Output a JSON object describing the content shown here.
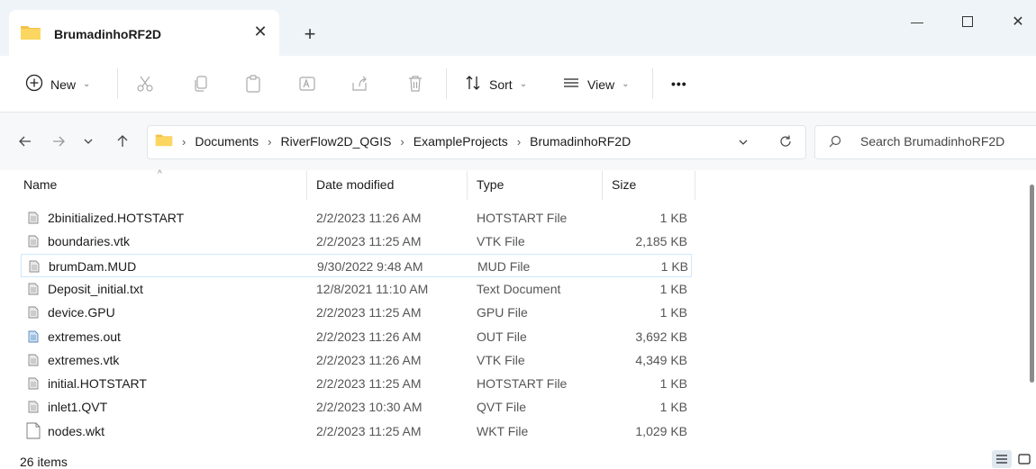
{
  "window": {
    "tab_title": "BrumadinhoRF2D",
    "new_tab": "+",
    "close_tab": "✕",
    "minimize": "—",
    "maximize": "☐",
    "close": "✕"
  },
  "commands": {
    "new_label": "New",
    "sort_label": "Sort",
    "view_label": "View",
    "more_label": "•••"
  },
  "breadcrumbs": [
    "Documents",
    "RiverFlow2D_QGIS",
    "ExampleProjects",
    "BrumadinhoRF2D"
  ],
  "search": {
    "placeholder": "Search BrumadinhoRF2D"
  },
  "columns": {
    "name": "Name",
    "date": "Date modified",
    "type": "Type",
    "size": "Size"
  },
  "files": [
    {
      "name": "2binitialized.HOTSTART",
      "date": "2/2/2023 11:26 AM",
      "type": "HOTSTART File",
      "size": "1 KB",
      "icon": "file-icon"
    },
    {
      "name": "boundaries.vtk",
      "date": "2/2/2023 11:25 AM",
      "type": "VTK File",
      "size": "2,185 KB",
      "icon": "file-icon"
    },
    {
      "name": "brumDam.MUD",
      "date": "9/30/2022 9:48 AM",
      "type": "MUD File",
      "size": "1 KB",
      "icon": "file-icon"
    },
    {
      "name": "Deposit_initial.txt",
      "date": "12/8/2021 11:10 AM",
      "type": "Text Document",
      "size": "1 KB",
      "icon": "file-icon"
    },
    {
      "name": "device.GPU",
      "date": "2/2/2023 11:25 AM",
      "type": "GPU File",
      "size": "1 KB",
      "icon": "file-icon"
    },
    {
      "name": "extremes.out",
      "date": "2/2/2023 11:26 AM",
      "type": "OUT File",
      "size": "3,692 KB",
      "icon": "out-file-icon"
    },
    {
      "name": "extremes.vtk",
      "date": "2/2/2023 11:26 AM",
      "type": "VTK File",
      "size": "4,349 KB",
      "icon": "file-icon"
    },
    {
      "name": "initial.HOTSTART",
      "date": "2/2/2023 11:25 AM",
      "type": "HOTSTART File",
      "size": "1 KB",
      "icon": "file-icon"
    },
    {
      "name": "inlet1.QVT",
      "date": "2/2/2023 10:30 AM",
      "type": "QVT File",
      "size": "1 KB",
      "icon": "file-icon"
    },
    {
      "name": "nodes.wkt",
      "date": "2/2/2023 11:25 AM",
      "type": "WKT File",
      "size": "1,029 KB",
      "icon": "blank-file-icon"
    }
  ],
  "selected_index": 2,
  "status": {
    "item_count": "26 items"
  },
  "colors": {
    "folder": "#f4c248",
    "accent": "#0067c0",
    "selection_border": "#cde8ff"
  }
}
